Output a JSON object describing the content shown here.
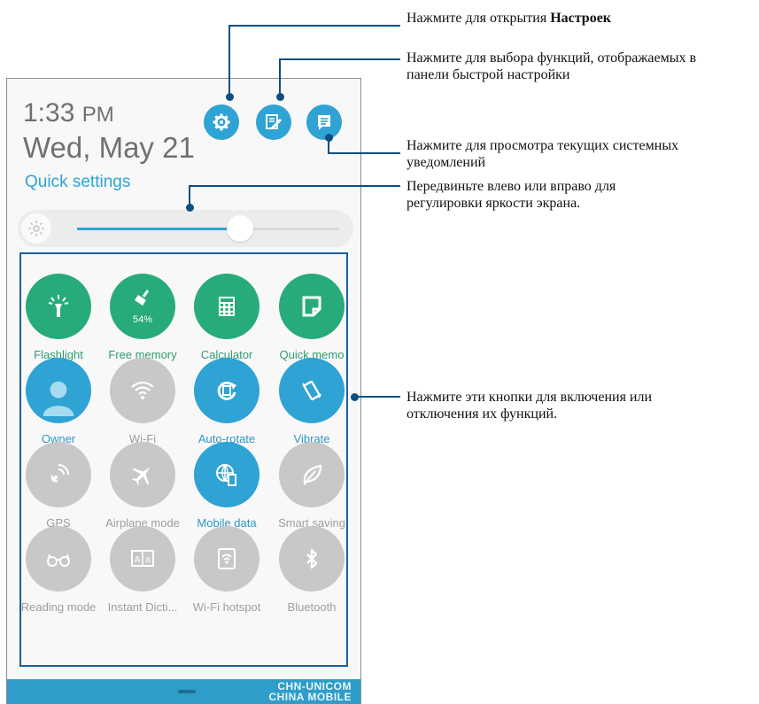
{
  "status": {
    "time": "1:33",
    "ampm": "PM",
    "date": "Wed, May 21",
    "quick_settings_label": "Quick settings"
  },
  "brightness": {
    "level": 0.62
  },
  "tiles": [
    {
      "label": "Flashlight",
      "icon": "flashlight-icon",
      "state": "green"
    },
    {
      "label": "Free memory",
      "icon": "broom-icon",
      "state": "green",
      "badge": "54%"
    },
    {
      "label": "Calculator",
      "icon": "calculator-icon",
      "state": "green"
    },
    {
      "label": "Quick memo",
      "icon": "memo-icon",
      "state": "green"
    },
    {
      "label": "Owner",
      "icon": "user-avatar-icon",
      "state": "blue"
    },
    {
      "label": "Wi-Fi",
      "icon": "wifi-icon",
      "state": "gray"
    },
    {
      "label": "Auto-rotate",
      "icon": "rotate-icon",
      "state": "blue"
    },
    {
      "label": "Vibrate",
      "icon": "vibrate-icon",
      "state": "blue"
    },
    {
      "label": "GPS",
      "icon": "gps-icon",
      "state": "gray"
    },
    {
      "label": "Airplane mode",
      "icon": "airplane-icon",
      "state": "gray"
    },
    {
      "label": "Mobile data",
      "icon": "globe-phone-icon",
      "state": "blue"
    },
    {
      "label": "Smart saving",
      "icon": "leaf-icon",
      "state": "gray"
    },
    {
      "label": "Reading mode",
      "icon": "glasses-icon",
      "state": "gray"
    },
    {
      "label": "Instant Dicti...",
      "icon": "dictionary-icon",
      "state": "gray"
    },
    {
      "label": "Wi-Fi hotspot",
      "icon": "hotspot-icon",
      "state": "gray"
    },
    {
      "label": "Bluetooth",
      "icon": "bluetooth-icon",
      "state": "gray"
    }
  ],
  "carrier": {
    "line1": "CHN-UNICOM",
    "line2": "CHINA MOBILE"
  },
  "callouts": {
    "settings_prefix": "Нажмите для открытия ",
    "settings_bold": "Настроек",
    "edit_line1": "Нажмите для выбора функций, отображаемых в",
    "edit_line2": "панели быстрой настройки",
    "notif_line1": "Нажмите для просмотра текущих системных",
    "notif_line2": "уведомлений",
    "bright_line1": "Передвиньте влево или вправо для",
    "bright_line2": "регулировки яркости экрана.",
    "tiles_line1": "Нажмите эти кнопки для включения или",
    "tiles_line2": "отключения их функций."
  },
  "colors": {
    "accent_blue": "#2ea3d4",
    "accent_green": "#27ab7a",
    "inactive_gray": "#c8c8c8",
    "callout_line": "#0e4f80"
  }
}
